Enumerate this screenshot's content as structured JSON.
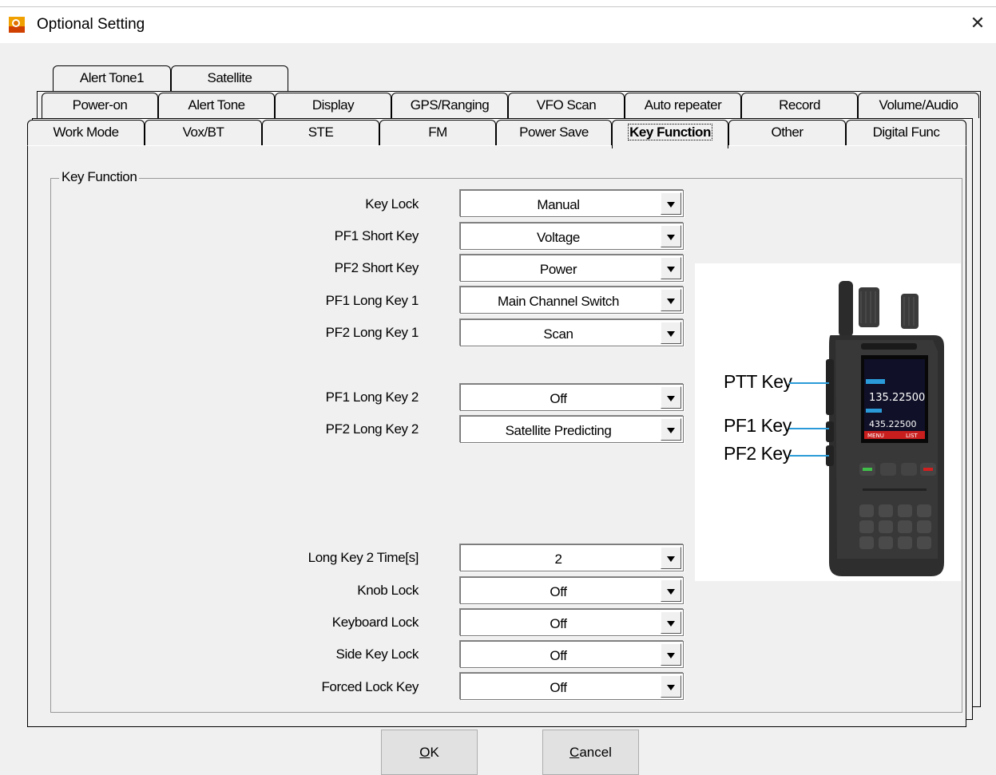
{
  "window": {
    "title": "Optional Setting",
    "close_glyph": "✕"
  },
  "tabs": {
    "row1": [
      "Alert Tone1",
      "Satellite"
    ],
    "row2": [
      "Power-on",
      "Alert Tone",
      "Display",
      "GPS/Ranging",
      "VFO Scan",
      "Auto repeater",
      "Record",
      "Volume/Audio"
    ],
    "row3": [
      "Work Mode",
      "Vox/BT",
      "STE",
      "FM",
      "Power Save",
      "Key Function",
      "Other",
      "Digital Func"
    ],
    "active": "Key Function"
  },
  "group": {
    "title": "Key Function"
  },
  "fields": [
    {
      "label": "Key Lock",
      "value": "Manual"
    },
    {
      "label": "PF1 Short Key",
      "value": "Voltage"
    },
    {
      "label": "PF2 Short Key",
      "value": "Power"
    },
    {
      "label": "PF1 Long Key 1",
      "value": "Main Channel Switch"
    },
    {
      "label": "PF2 Long Key 1",
      "value": "Scan"
    },
    {
      "label": "PF1 Long Key 2",
      "value": "Off"
    },
    {
      "label": "PF2 Long Key 2",
      "value": "Satellite Predicting"
    },
    {
      "label": "Long Key 2 Time[s]",
      "value": "2"
    },
    {
      "label": "Knob Lock",
      "value": "Off"
    },
    {
      "label": "Keyboard Lock",
      "value": "Off"
    },
    {
      "label": "Side Key Lock",
      "value": "Off"
    },
    {
      "label": "Forced Lock Key",
      "value": "Off"
    }
  ],
  "radio_image": {
    "labels": {
      "ptt": "PTT Key",
      "pf1": "PF1 Key",
      "pf2": "PF2 Key"
    },
    "screen_text": [
      "135.22500",
      "435.22500",
      "MENU",
      "LIST"
    ],
    "accent_color": "#2a9bd8"
  },
  "buttons": {
    "ok": {
      "mnemonic": "O",
      "rest": "K"
    },
    "cancel": {
      "mnemonic": "C",
      "rest": "ancel"
    }
  }
}
